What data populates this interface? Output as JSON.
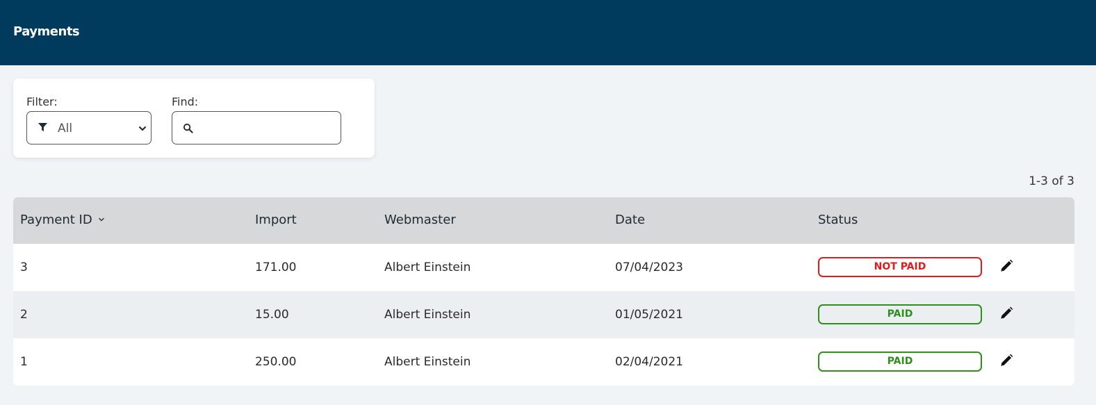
{
  "header": {
    "title": "Payments",
    "background": "#003a5c"
  },
  "filters": {
    "filter_label": "Filter:",
    "filter_value": "All",
    "find_label": "Find:",
    "find_value": "",
    "find_placeholder": ""
  },
  "pagination": {
    "text": "1-3 of 3"
  },
  "table": {
    "columns": [
      "Payment ID",
      "Import",
      "Webmaster",
      "Date",
      "Status"
    ],
    "sorted_column": "Payment ID",
    "rows": [
      {
        "id": "3",
        "import": "171.00",
        "webmaster": "Albert Einstein",
        "date": "07/04/2023",
        "status": "NOT PAID"
      },
      {
        "id": "2",
        "import": "15.00",
        "webmaster": "Albert Einstein",
        "date": "01/05/2021",
        "status": "PAID"
      },
      {
        "id": "1",
        "import": "250.00",
        "webmaster": "Albert Einstein",
        "date": "02/04/2021",
        "status": "PAID"
      }
    ]
  },
  "colors": {
    "not_paid": "#e01b1b",
    "paid": "#2f8f1d"
  },
  "icons": {
    "filter": "funnel-icon",
    "dropdown": "chevron-down-icon",
    "search": "search-icon",
    "sort": "chevron-down-icon",
    "edit": "pencil-icon"
  }
}
